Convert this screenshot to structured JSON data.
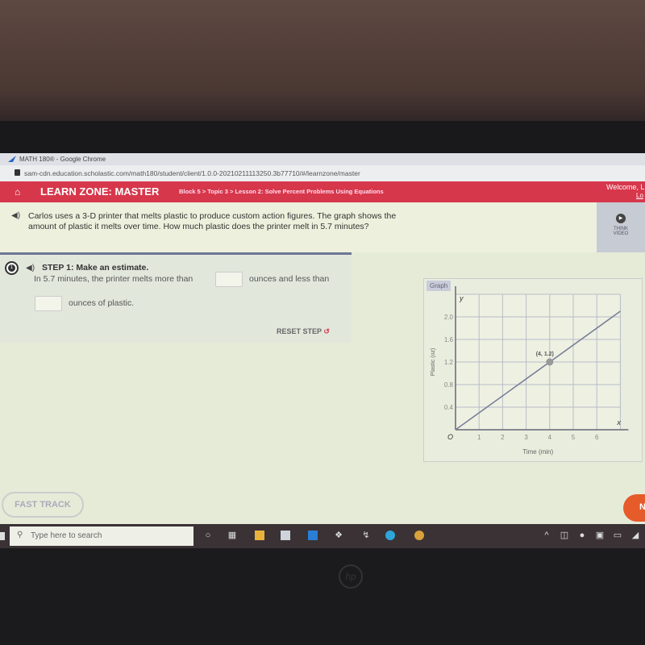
{
  "browser": {
    "title": "MATH 180® - Google Chrome",
    "url": "sam-cdn.education.scholastic.com/math180/student/client/1.0.0-20210211113250.3b77710/#/learnzone/master"
  },
  "header": {
    "title": "LEARN ZONE: MASTER",
    "breadcrumb": "Block 5 > Topic 3 > Lesson 2: Solve Percent Problems Using Equations",
    "welcome": "Welcome, L",
    "logout": "Lo",
    "color": "#d7374b"
  },
  "question": {
    "text": "Carlos uses a 3-D printer that melts plastic to produce custom action figures. The graph shows the amount of plastic it melts over time. How much plastic does the printer melt in 5.7 minutes?"
  },
  "think_video": {
    "label1": "THINK",
    "label2": "VIDEO"
  },
  "step": {
    "number": "1",
    "title": "STEP 1: Make an estimate.",
    "text1": "In 5.7 minutes, the printer melts more than",
    "text2": "ounces and less than",
    "text3": "ounces of plastic.",
    "input1": "",
    "input2": "",
    "reset": "RESET STEP"
  },
  "graph": {
    "tab": "Graph"
  },
  "chart_data": {
    "type": "line",
    "xlabel": "Time (min)",
    "ylabel": "Plastic (oz)",
    "x_axis_symbol": "x",
    "y_axis_symbol": "y",
    "origin_label": "O",
    "xlim": [
      0,
      7
    ],
    "ylim": [
      0,
      2.4
    ],
    "x_ticks": [
      "1",
      "2",
      "3",
      "4",
      "5",
      "6"
    ],
    "y_ticks": [
      "0.4",
      "0.8",
      "1.2",
      "1.6",
      "2.0"
    ],
    "grid": true,
    "series": [
      {
        "x": [
          0,
          7
        ],
        "y": [
          0,
          2.1
        ]
      }
    ],
    "points": [
      {
        "x": 4,
        "y": 1.2,
        "label": "(4, 1.2)"
      }
    ]
  },
  "footer": {
    "fast_track": "FAST TRACK",
    "next": "N"
  },
  "taskbar": {
    "search_placeholder": "Type here to search"
  },
  "laptop": {
    "brand": "hp"
  }
}
